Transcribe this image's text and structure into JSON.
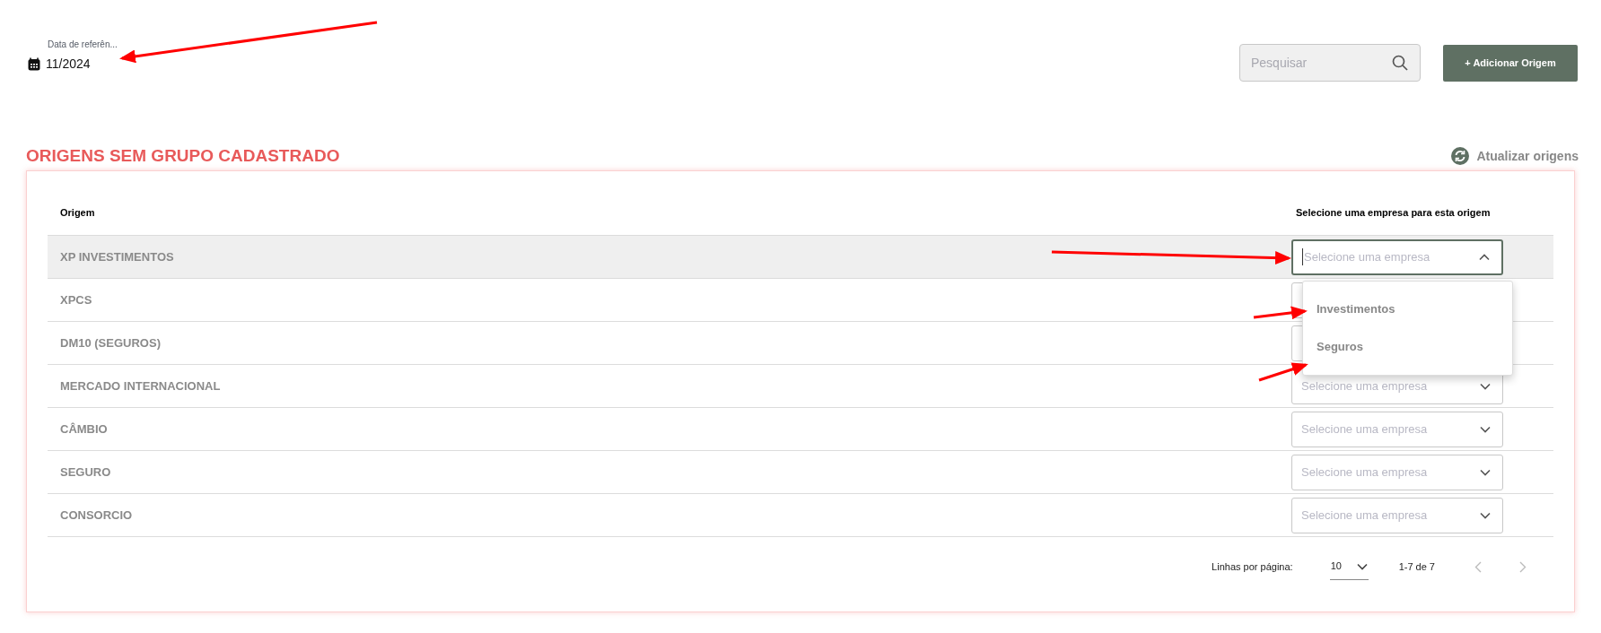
{
  "date_filter": {
    "label": "Data de referên...",
    "value": "11/2024"
  },
  "search": {
    "placeholder": "Pesquisar"
  },
  "add_button": "+ Adicionar Origem",
  "section_title": "ORIGENS SEM GRUPO CADASTRADO",
  "refresh_button": "Atualizar origens",
  "table": {
    "columns": [
      "Origem",
      "Selecione uma empresa para esta origem"
    ],
    "rows": [
      {
        "origin": "XP INVESTIMENTOS",
        "placeholder": "Selecione uma empresa",
        "expanded": true
      },
      {
        "origin": "XPCS",
        "expanded": false
      },
      {
        "origin": "DM10 (SEGUROS)",
        "expanded": false
      },
      {
        "origin": "MERCADO INTERNACIONAL",
        "placeholder": "Selecione uma empresa",
        "expanded": false
      },
      {
        "origin": "CÂMBIO",
        "placeholder": "Selecione uma empresa",
        "expanded": false
      },
      {
        "origin": "SEGURO",
        "placeholder": "Selecione uma empresa",
        "expanded": false
      },
      {
        "origin": "CONSORCIO",
        "placeholder": "Selecione uma empresa",
        "expanded": false
      }
    ]
  },
  "dropdown_options": [
    "Investimentos",
    "Seguros"
  ],
  "pagination": {
    "rows_label": "Linhas por página:",
    "rows_per_page": "10",
    "range": "1-7 de 7"
  }
}
